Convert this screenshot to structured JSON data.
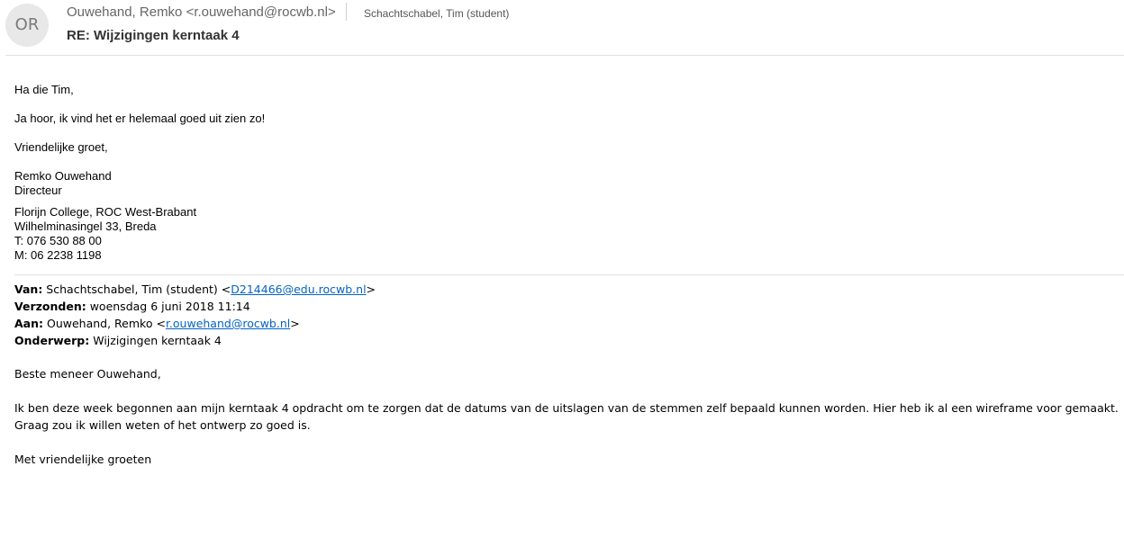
{
  "header": {
    "avatar_initials": "OR",
    "sender": "Ouwehand, Remko <r.ouwehand@rocwb.nl>",
    "recipient": "Schachtschabel, Tim  (student)",
    "subject": "RE: Wijzigingen kerntaak 4"
  },
  "reply": {
    "greeting": "Ha die Tim,",
    "body": "Ja hoor, ik vind het er helemaal goed uit zien zo!",
    "closing": "Vriendelijke groet,",
    "signature": {
      "name": "Remko Ouwehand",
      "title": "Directeur",
      "org": "Florijn College, ROC West-Brabant",
      "address": "Wilhelminasingel 33, Breda",
      "phone": "T: 076 530 88 00",
      "mobile": "M: 06 2238 1198"
    }
  },
  "original": {
    "from_label": "Van:",
    "from_name": " Schachtschabel, Tim (student) <",
    "from_email": "D214466@edu.rocwb.nl",
    "from_end": ">",
    "sent_label": "Verzonden:",
    "sent_value": " woensdag 6 juni 2018 11:14",
    "to_label": "Aan:",
    "to_name": " Ouwehand, Remko <",
    "to_email": "r.ouwehand@rocwb.nl",
    "to_end": ">",
    "subject_label": "Onderwerp:",
    "subject_value": " Wijzigingen kerntaak 4",
    "greeting": "Beste meneer Ouwehand,",
    "body_line1": "Ik ben deze week begonnen aan mijn kerntaak 4 opdracht om te zorgen dat de datums van de uitslagen van de stemmen zelf bepaald kunnen worden. Hier heb ik al een wireframe voor gemaakt.",
    "body_line2": "Graag zou ik willen weten of het ontwerp zo goed is.",
    "closing": "Met vriendelijke groeten"
  }
}
